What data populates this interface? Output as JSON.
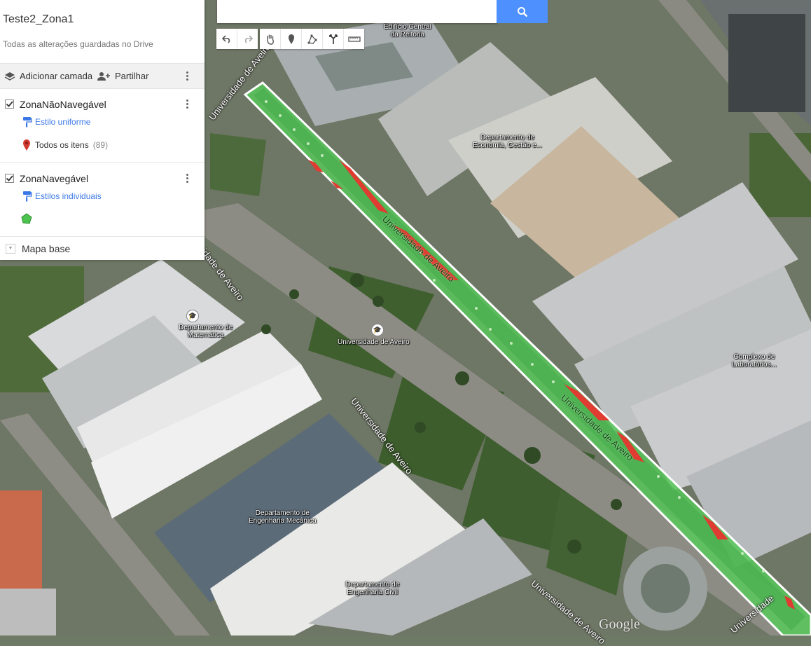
{
  "panel": {
    "title": "Teste2_Zona1",
    "save_status": "Todas as alterações guardadas no Drive",
    "add_layer_label": "Adicionar camada",
    "share_label": "Partilhar",
    "layers": [
      {
        "name": "ZonaNãoNavegável",
        "style_label": "Estilo uniforme",
        "items_label": "Todos os itens",
        "items_count": "(89)",
        "checked": true
      },
      {
        "name": "ZonaNavegável",
        "style_label": "Estilos individuais",
        "checked": true
      }
    ],
    "basemap_label": "Mapa base"
  },
  "search": {
    "value": "",
    "placeholder": ""
  },
  "toolbar": {
    "tools": [
      "undo-icon",
      "redo-icon",
      "hand-icon",
      "marker-icon",
      "draw-line-icon",
      "directions-icon",
      "ruler-icon"
    ]
  },
  "map": {
    "labels": {
      "reitoria": "Edifício Central\nda Reitoria",
      "economia": "Departamento de\nEconomia, Gestão e...",
      "matematica": "Departamento de\nMatemática",
      "universidade": "Universidade de Aveiro",
      "laboratorios": "Complexo de\nLaboratórios...",
      "mecanica": "Departamento de\nEngenharia Mecânica",
      "civil": "Departamento de\nEngenharia Civil"
    },
    "roads": {
      "road_top": "Universidade de Aveiro",
      "road_mid": "Universidade de Aveiro",
      "road_left": "idade de Aveiro",
      "road_bottom": "Universidade de Aveiro",
      "road_green_a": "Universidade de Aveiro",
      "road_green_b": "Universidade de Aveiro",
      "road_bottom_right": "Universidade"
    },
    "watermark": "Google",
    "colors": {
      "navigable": "#3fbf3f",
      "non_navigable": "#e03c31"
    }
  }
}
